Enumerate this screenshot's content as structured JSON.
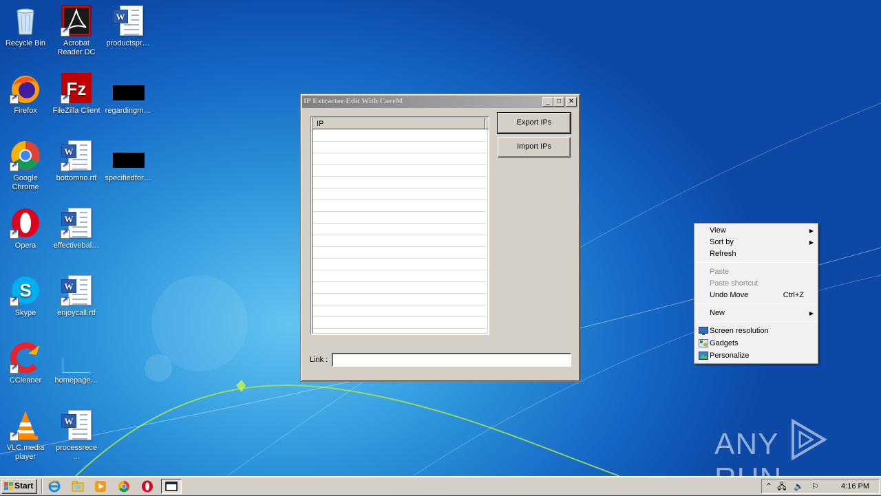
{
  "desktop": {
    "icons": [
      {
        "id": "recycle-bin",
        "label": "Recycle Bin"
      },
      {
        "id": "acrobat-reader",
        "label": "Acrobat Reader DC"
      },
      {
        "id": "productspr",
        "label": "productspr…"
      },
      {
        "id": "firefox",
        "label": "Firefox"
      },
      {
        "id": "filezilla",
        "label": "FileZilla Client"
      },
      {
        "id": "regardingm",
        "label": "regardingm…"
      },
      {
        "id": "google-chrome",
        "label": "Google Chrome"
      },
      {
        "id": "bottomno",
        "label": "bottomno.rtf"
      },
      {
        "id": "specifiedfor",
        "label": "specifiedfor…"
      },
      {
        "id": "opera",
        "label": "Opera"
      },
      {
        "id": "effectivebal",
        "label": "effectivebal…"
      },
      {
        "id": "skype",
        "label": "Skype"
      },
      {
        "id": "enjoycall",
        "label": "enjoycall.rtf"
      },
      {
        "id": "ccleaner",
        "label": "CCleaner"
      },
      {
        "id": "homepage",
        "label": "homepage…"
      },
      {
        "id": "vlc",
        "label": "VLC media player"
      },
      {
        "id": "processrece",
        "label": "processrece…"
      }
    ]
  },
  "window": {
    "title": "IP Extractor Edit With CorrM",
    "list_header": "IP",
    "export_label": "Export IPs",
    "import_label": "Import IPs",
    "link_label": "Link :",
    "link_value": ""
  },
  "context_menu": {
    "items": [
      {
        "label": "View",
        "submenu": true,
        "disabled": false
      },
      {
        "label": "Sort by",
        "submenu": true,
        "disabled": false
      },
      {
        "label": "Refresh",
        "submenu": false,
        "disabled": false
      },
      {
        "label": "Paste",
        "submenu": false,
        "disabled": true
      },
      {
        "label": "Paste shortcut",
        "submenu": false,
        "disabled": true
      },
      {
        "label": "Undo Move",
        "shortcut": "Ctrl+Z",
        "submenu": false,
        "disabled": false
      },
      {
        "label": "New",
        "submenu": true,
        "disabled": false
      },
      {
        "label": "Screen resolution",
        "icon": "monitor-icon",
        "submenu": false,
        "disabled": false
      },
      {
        "label": "Gadgets",
        "icon": "gadgets-icon",
        "submenu": false,
        "disabled": false
      },
      {
        "label": "Personalize",
        "icon": "personalize-icon",
        "submenu": false,
        "disabled": false
      }
    ]
  },
  "taskbar": {
    "start_label": "Start",
    "clock": "4:16 PM",
    "pinned": [
      "internet-explorer",
      "file-explorer",
      "media-player",
      "chrome",
      "opera",
      "active-window"
    ]
  },
  "watermark": {
    "text_left": "ANY",
    "text_right": "RUN"
  }
}
